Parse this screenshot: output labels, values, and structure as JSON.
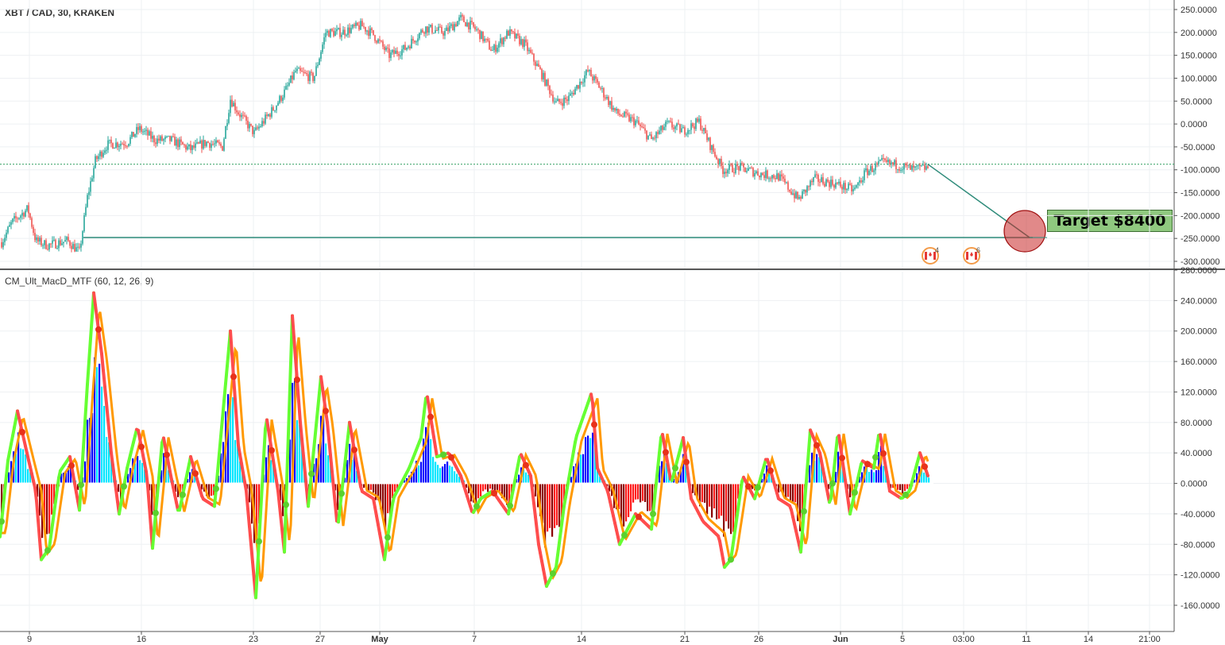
{
  "symbol": "XBT / CAD, 30, KRAKEN",
  "indicator": "CM_Ult_MacD_MTF (60, 12, 26, 9)",
  "annotation": {
    "label": "Target $8400"
  },
  "event_badges": [
    "4",
    "6"
  ],
  "colors": {
    "bull": "#26a69a",
    "bear": "#ef5350",
    "line": "#2e8b7a",
    "hist_up_strong": "#0000ff",
    "hist_up_weak": "#00e5ff",
    "hist_dn_strong": "#8b0000",
    "hist_dn_weak": "#ff1a1a",
    "macd_up": "#66ff33",
    "macd_dn": "#ff4d4d",
    "signal": "#ff9900"
  },
  "chart_data": [
    {
      "type": "candlestick",
      "ylim": [
        -320,
        250
      ],
      "y_ticks": [
        "250.0000",
        "200.0000",
        "150.0000",
        "100.0000",
        "50.0000",
        "0.0000",
        "-50.0000",
        "-100.0000",
        "-150.0000",
        "-200.0000",
        "-250.0000",
        "-300.0000"
      ],
      "x_ticks": [
        "9",
        "16",
        "23",
        "27",
        "May",
        "7",
        "14",
        "21",
        "26",
        "Jun",
        "5",
        "03:00",
        "11",
        "14",
        "21:00"
      ],
      "horizontal_lines": [
        -88,
        -248
      ],
      "price_path": [
        [
          0,
          -265
        ],
        [
          15,
          -215
        ],
        [
          35,
          -185
        ],
        [
          45,
          -255
        ],
        [
          60,
          -265
        ],
        [
          85,
          -255
        ],
        [
          100,
          -280
        ],
        [
          110,
          -160
        ],
        [
          120,
          -80
        ],
        [
          135,
          -45
        ],
        [
          160,
          -40
        ],
        [
          175,
          -10
        ],
        [
          195,
          -35
        ],
        [
          215,
          -35
        ],
        [
          240,
          -55
        ],
        [
          260,
          -40
        ],
        [
          280,
          -50
        ],
        [
          290,
          55
        ],
        [
          300,
          25
        ],
        [
          320,
          -20
        ],
        [
          345,
          35
        ],
        [
          360,
          75
        ],
        [
          372,
          115
        ],
        [
          395,
          100
        ],
        [
          410,
          200
        ],
        [
          430,
          200
        ],
        [
          455,
          215
        ],
        [
          470,
          195
        ],
        [
          490,
          150
        ],
        [
          510,
          165
        ],
        [
          535,
          210
        ],
        [
          560,
          200
        ],
        [
          580,
          230
        ],
        [
          600,
          205
        ],
        [
          620,
          160
        ],
        [
          640,
          200
        ],
        [
          660,
          175
        ],
        [
          680,
          115
        ],
        [
          700,
          45
        ],
        [
          715,
          55
        ],
        [
          740,
          115
        ],
        [
          755,
          80
        ],
        [
          775,
          25
        ],
        [
          800,
          5
        ],
        [
          820,
          -35
        ],
        [
          840,
          0
        ],
        [
          860,
          -15
        ],
        [
          880,
          5
        ],
        [
          895,
          -50
        ],
        [
          910,
          -100
        ],
        [
          930,
          -95
        ],
        [
          960,
          -110
        ],
        [
          980,
          -115
        ],
        [
          1005,
          -165
        ],
        [
          1025,
          -120
        ],
        [
          1050,
          -130
        ],
        [
          1075,
          -145
        ],
        [
          1090,
          -105
        ],
        [
          1110,
          -85
        ],
        [
          1130,
          -90
        ],
        [
          1150,
          -100
        ],
        [
          1168,
          -95
        ]
      ],
      "trend_line": {
        "from": {
          "x": "Jun 6",
          "y": -88
        },
        "to": {
          "x": "Jun 11",
          "y": -248
        }
      }
    },
    {
      "type": "histogram+line",
      "title": "CM_Ult_MacD_MTF (60, 12, 26, 9)",
      "ylim": [
        -170,
        280
      ],
      "y_ticks": [
        "280.0000",
        "240.0000",
        "200.0000",
        "160.0000",
        "120.0000",
        "80.0000",
        "40.0000",
        "0.0000",
        "-40.0000",
        "-80.0000",
        "-120.0000",
        "-160.0000"
      ],
      "macd_path": [
        [
          0,
          -70
        ],
        [
          10,
          30
        ],
        [
          22,
          95
        ],
        [
          35,
          35
        ],
        [
          45,
          -10
        ],
        [
          52,
          -100
        ],
        [
          62,
          -85
        ],
        [
          75,
          15
        ],
        [
          88,
          35
        ],
        [
          100,
          -35
        ],
        [
          110,
          130
        ],
        [
          118,
          250
        ],
        [
          128,
          170
        ],
        [
          140,
          40
        ],
        [
          150,
          -40
        ],
        [
          160,
          20
        ],
        [
          173,
          75
        ],
        [
          185,
          10
        ],
        [
          192,
          -85
        ],
        [
          205,
          65
        ],
        [
          215,
          10
        ],
        [
          225,
          -40
        ],
        [
          240,
          35
        ],
        [
          255,
          -20
        ],
        [
          270,
          -30
        ],
        [
          290,
          200
        ],
        [
          300,
          50
        ],
        [
          310,
          -10
        ],
        [
          322,
          -150
        ],
        [
          335,
          90
        ],
        [
          350,
          -10
        ],
        [
          358,
          -90
        ],
        [
          368,
          220
        ],
        [
          378,
          80
        ],
        [
          388,
          -30
        ],
        [
          404,
          140
        ],
        [
          412,
          80
        ],
        [
          425,
          -60
        ],
        [
          440,
          80
        ],
        [
          455,
          -10
        ],
        [
          470,
          -20
        ],
        [
          484,
          -100
        ],
        [
          495,
          -20
        ],
        [
          515,
          20
        ],
        [
          530,
          60
        ],
        [
          537,
          120
        ],
        [
          550,
          35
        ],
        [
          565,
          40
        ],
        [
          580,
          10
        ],
        [
          595,
          -40
        ],
        [
          605,
          -20
        ],
        [
          620,
          -10
        ],
        [
          640,
          -40
        ],
        [
          655,
          40
        ],
        [
          668,
          10
        ],
        [
          678,
          -80
        ],
        [
          688,
          -135
        ],
        [
          700,
          -110
        ],
        [
          710,
          -30
        ],
        [
          725,
          60
        ],
        [
          745,
          120
        ],
        [
          752,
          20
        ],
        [
          765,
          -10
        ],
        [
          780,
          -80
        ],
        [
          800,
          -40
        ],
        [
          820,
          -60
        ],
        [
          833,
          70
        ],
        [
          845,
          0
        ],
        [
          860,
          60
        ],
        [
          870,
          -20
        ],
        [
          885,
          -50
        ],
        [
          905,
          -70
        ],
        [
          912,
          -110
        ],
        [
          920,
          -100
        ],
        [
          935,
          10
        ],
        [
          950,
          -20
        ],
        [
          965,
          35
        ],
        [
          980,
          -20
        ],
        [
          995,
          -30
        ],
        [
          1008,
          -90
        ],
        [
          1020,
          70
        ],
        [
          1032,
          40
        ],
        [
          1045,
          -30
        ],
        [
          1055,
          70
        ],
        [
          1070,
          -40
        ],
        [
          1085,
          30
        ],
        [
          1100,
          20
        ],
        [
          1107,
          70
        ],
        [
          1120,
          -10
        ],
        [
          1135,
          -20
        ],
        [
          1145,
          -10
        ],
        [
          1158,
          40
        ],
        [
          1168,
          10
        ]
      ]
    }
  ]
}
